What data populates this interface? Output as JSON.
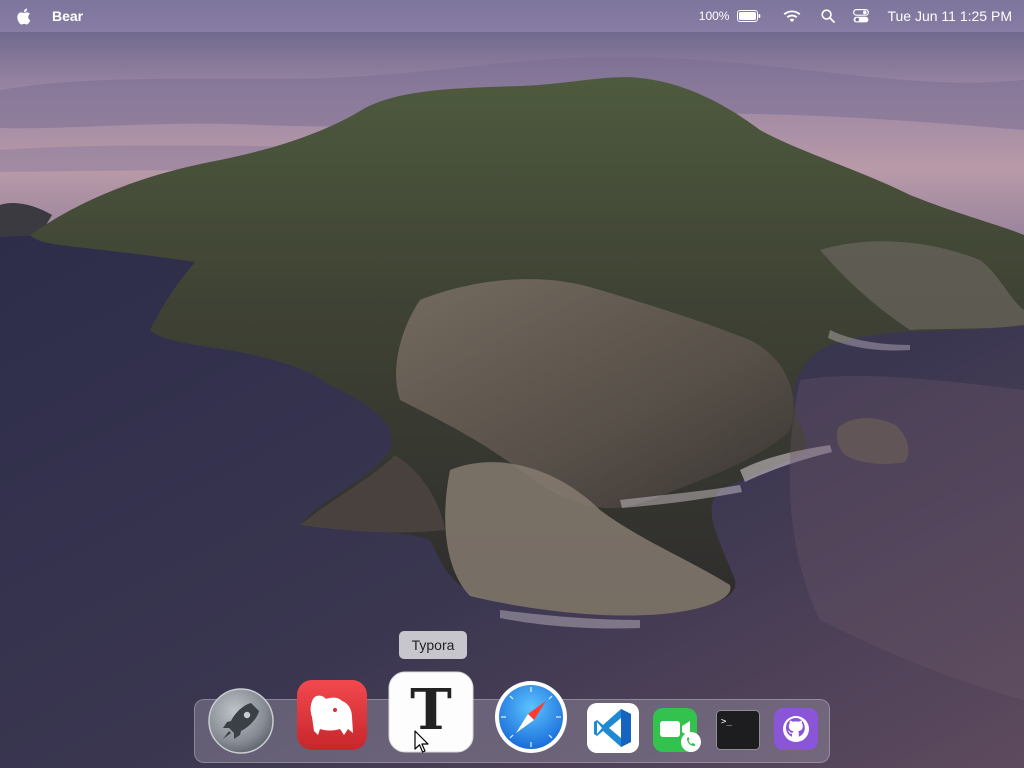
{
  "menubar": {
    "app_name": "Bear",
    "battery_percent": "100%",
    "clock": "Tue Jun 11  1:25 PM",
    "icons": [
      "apple-icon",
      "battery-icon",
      "wifi-icon",
      "search-icon",
      "control-center-icon"
    ]
  },
  "dock": {
    "tooltip": "Typora",
    "apps": [
      {
        "name": "Launchpad",
        "icon": "launchpad-icon"
      },
      {
        "name": "Bear",
        "icon": "bear-icon"
      },
      {
        "name": "Typora",
        "icon": "typora-icon"
      },
      {
        "name": "Safari",
        "icon": "safari-icon"
      },
      {
        "name": "Visual Studio Code",
        "icon": "vscode-icon"
      },
      {
        "name": "FaceTime",
        "icon": "facetime-icon"
      },
      {
        "name": "Terminal",
        "icon": "terminal-icon"
      },
      {
        "name": "GitHub Desktop",
        "icon": "github-icon"
      }
    ]
  },
  "desktop": {
    "wallpaper": "catalina-island"
  },
  "colors": {
    "menubar_bg": "#9b8cb4",
    "bear_red": "#e0353b",
    "safari_blue": "#1e88e5",
    "vscode_blue": "#1f8ad2",
    "facetime_green": "#32c24d",
    "github_purple": "#8a55d6"
  }
}
